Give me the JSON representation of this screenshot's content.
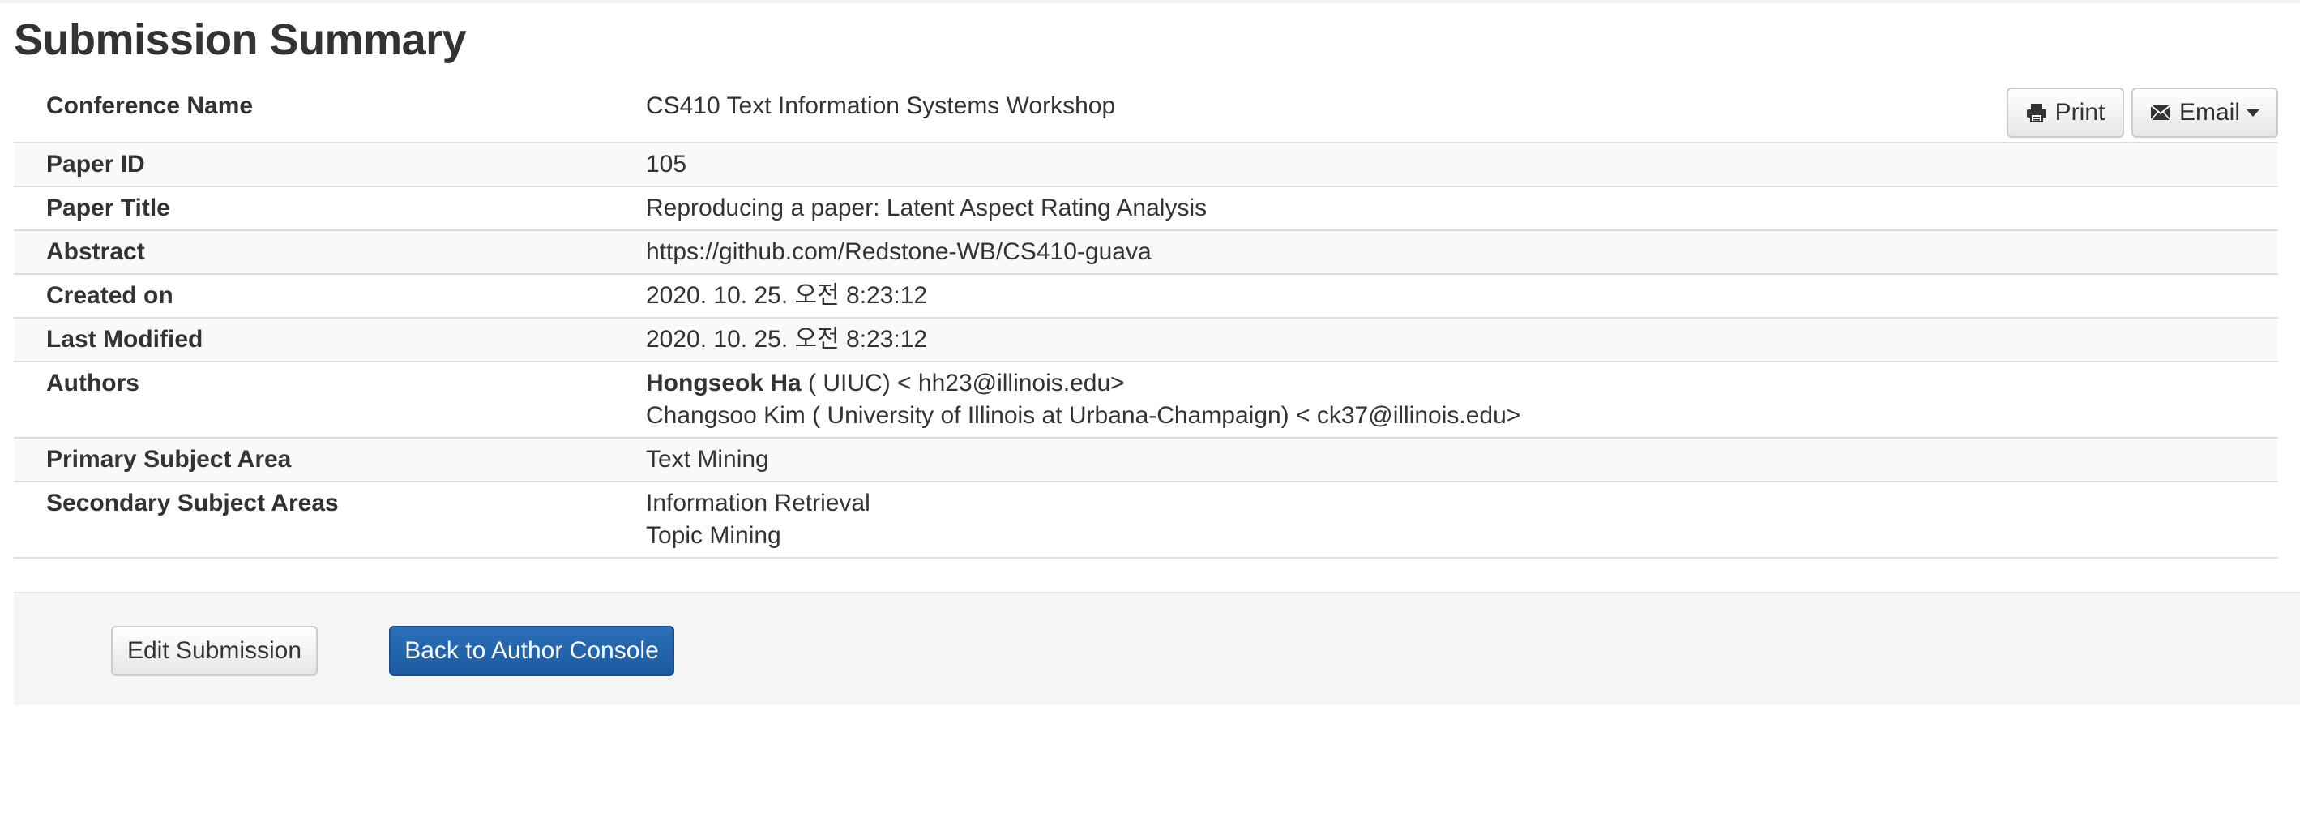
{
  "page": {
    "title": "Submission Summary"
  },
  "header_buttons": {
    "print_label": "Print",
    "print_icon": "printer-icon",
    "email_label": "Email",
    "email_icon": "envelope-icon"
  },
  "summary": {
    "conference_name": {
      "label": "Conference Name",
      "value": "CS410 Text Information Systems Workshop"
    },
    "paper_id": {
      "label": "Paper ID",
      "value": "105"
    },
    "paper_title": {
      "label": "Paper Title",
      "value": "Reproducing a paper: Latent Aspect Rating Analysis"
    },
    "abstract": {
      "label": "Abstract",
      "value": "https://github.com/Redstone-WB/CS410-guava"
    },
    "created_on": {
      "label": "Created on",
      "value": "2020. 10. 25. 오전 8:23:12"
    },
    "last_modified": {
      "label": "Last Modified",
      "value": "2020. 10. 25. 오전 8:23:12"
    },
    "authors": {
      "label": "Authors",
      "items": [
        {
          "name": "Hongseok Ha",
          "detail": " ( UIUC) < hh23@illinois.edu>"
        },
        {
          "name": "Changsoo Kim",
          "detail": " ( University of Illinois at Urbana-Champaign) < ck37@illinois.edu>"
        }
      ]
    },
    "primary_subject_area": {
      "label": "Primary Subject Area",
      "value": "Text Mining"
    },
    "secondary_subject_areas": {
      "label": "Secondary Subject Areas",
      "items": [
        "Information Retrieval",
        "Topic Mining"
      ]
    }
  },
  "actions": {
    "edit_label": "Edit Submission",
    "back_label": "Back to Author Console"
  },
  "colors": {
    "primary_button": "#1c5aa0",
    "stripe": "#f9f9f9",
    "border": "#dddddd",
    "actions_bg": "#f5f5f5"
  }
}
